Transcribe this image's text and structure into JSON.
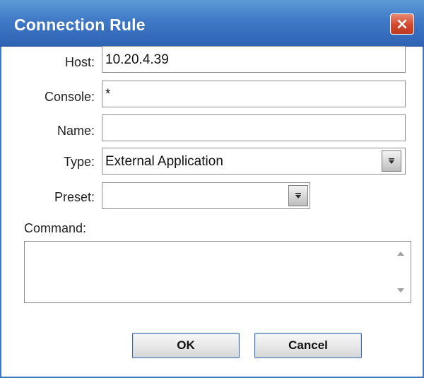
{
  "window": {
    "title": "Connection Rule",
    "close_icon": "×"
  },
  "form": {
    "host": {
      "label": "Host:",
      "value": "10.20.4.39"
    },
    "console": {
      "label": "Console:",
      "value": "*"
    },
    "name": {
      "label": "Name:",
      "value": ""
    },
    "type": {
      "label": "Type:",
      "value": "External Application"
    },
    "preset": {
      "label": "Preset:",
      "value": ""
    },
    "command": {
      "label": "Command:",
      "value": ""
    }
  },
  "buttons": {
    "ok_label": "OK",
    "cancel_label": "Cancel"
  },
  "icons": {
    "close": "close-icon",
    "dropdown": "chevron-down-icon",
    "scroll_up": "scroll-up-icon",
    "scroll_down": "scroll-down-icon"
  },
  "colors": {
    "titlebar": "#3f79c6",
    "close_button": "#d3472c",
    "button_border": "#3a6aa8"
  }
}
